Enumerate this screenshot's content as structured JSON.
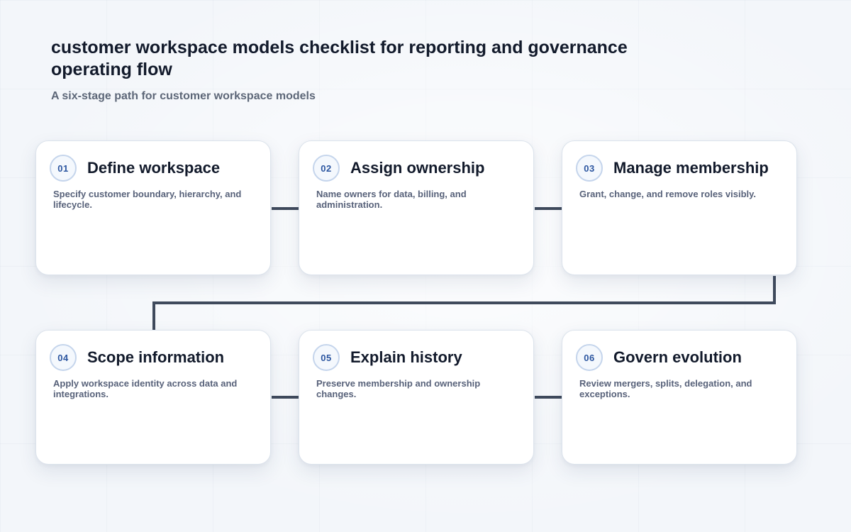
{
  "header": {
    "title": "customer workspace models checklist for reporting and governance operating flow",
    "subtitle": "A six-stage path for customer workspace models"
  },
  "colors": {
    "connector": "#3f4a5c",
    "badge_text": "#2c56a0",
    "badge_border": "#c5d5ec",
    "title_text": "#121a2b",
    "desc_text": "#58627a"
  },
  "steps": [
    {
      "number": "01",
      "title": "Define workspace",
      "description": "Specify customer boundary, hierarchy, and lifecycle."
    },
    {
      "number": "02",
      "title": "Assign ownership",
      "description": "Name owners for data, billing, and administration."
    },
    {
      "number": "03",
      "title": "Manage membership",
      "description": "Grant, change, and remove roles visibly."
    },
    {
      "number": "04",
      "title": "Scope information",
      "description": "Apply workspace identity across data and integrations."
    },
    {
      "number": "05",
      "title": "Explain history",
      "description": "Preserve membership and ownership changes."
    },
    {
      "number": "06",
      "title": "Govern evolution",
      "description": "Review mergers, splits, delegation, and exceptions."
    }
  ]
}
